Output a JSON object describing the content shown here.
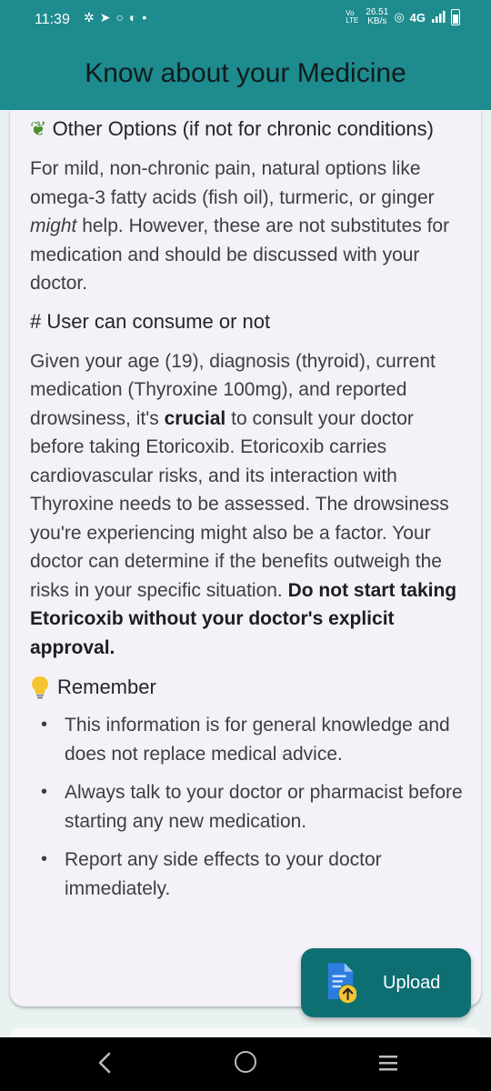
{
  "status_bar": {
    "time": "11:39",
    "left_icons": [
      "app-icon",
      "navigation-icon",
      "circle-icon",
      "record-icon",
      "dot-icon"
    ],
    "volte": "Vo LTE",
    "speed_value": "26.51",
    "speed_unit": "KB/s",
    "network": "4G"
  },
  "app_bar": {
    "title": "Know about your Medicine"
  },
  "content": {
    "other_options_heading": "Other Options (if not for chronic conditions)",
    "other_options_icon": "herb-icon",
    "other_options_text_before": "For mild, non-chronic pain, natural options like omega-3 fatty acids (fish oil), turmeric, or ginger ",
    "other_options_italic": "might",
    "other_options_text_after": " help.  However, these are not substitutes for medication and should be discussed with your doctor.",
    "consume_heading": "# User can consume or not",
    "consume_text_before": "Given your age (19), diagnosis (thyroid), current medication (Thyroxine 100mg), and reported drowsiness, it's ",
    "consume_bold_word": "crucial",
    "consume_text_after": " to consult your doctor before taking Etoricoxib. Etoricoxib carries cardiovascular risks, and its interaction with Thyroxine needs to be assessed.  The drowsiness you're experiencing might also be a factor.  Your doctor can determine if the benefits outweigh the risks in your specific situation. ",
    "consume_bold_warning": "Do not start taking Etoricoxib without your doctor's explicit approval.",
    "remember_heading": "Remember",
    "remember_icon": "lightbulb-icon",
    "bullets": [
      "This information is for general knowledge and does not replace medical advice.",
      "Always talk to your doctor or pharmacist before starting any new medication.",
      "Report any side effects to your doctor immediately."
    ]
  },
  "fab": {
    "label": "Upload",
    "icon": "document-upload-icon"
  },
  "nav_bar": {
    "buttons": [
      "back-icon",
      "home-icon",
      "recents-icon"
    ]
  },
  "colors": {
    "brand_teal": "#1e8b8e",
    "fab_teal": "#0e6f73",
    "card_background": "#f4f2f8",
    "text": "#3f3c44"
  }
}
